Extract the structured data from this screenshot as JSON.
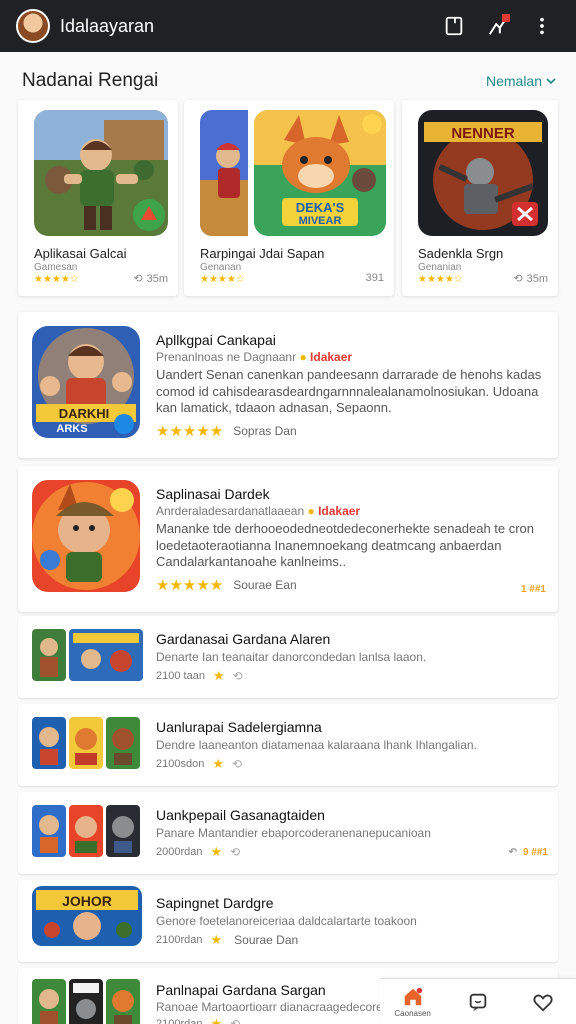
{
  "app": {
    "title": "Idalaayaran"
  },
  "section": {
    "title": "Nadanai Rengai",
    "see_more": "Nemalan"
  },
  "featured": [
    {
      "name": "Aplikasai Galcai",
      "category": "Gamesan",
      "stars": "★★★★☆",
      "downloads": "35m"
    },
    {
      "name": "Rarpingai Jdai Sapan",
      "category": "Genanan",
      "stars": "★★★★☆",
      "downloads": "391"
    },
    {
      "name": "Sadenkla Srgn",
      "category": "Genanian",
      "stars": "★★★★☆",
      "downloads": "35m"
    }
  ],
  "big_cards": [
    {
      "title": "Apllkgpai Cankapai",
      "subtitle": "Prenanlnoas ne Dagnaanr",
      "tag": "Idakaer",
      "description": "Uandert Senan canenkan pandeesann darrarade de henohs kadas comod id cahisdearasdeardngarnnnalealanamolnosiukan. Udoana kan lamatick, tdaaon adnasan, Sepaonn.",
      "rating_text": "Sopras Dan",
      "corner": ""
    },
    {
      "title": "Saplinasai Dardek",
      "subtitle": "Anrderaladesardanatlaaean",
      "tag": "Idakaer",
      "description": "Mananke tde derhooeodedneotdedeconerhekte senadeah te cron loedetaoteraotianna Inanemnoekang deatmcang anbaerdan Candalarkantanoahe kanlneims..",
      "rating_text": "Sourae Ean",
      "corner": "1 ##1"
    }
  ],
  "rows": [
    {
      "title": "Gardanasai Gardana Alaren",
      "subtitle": "Denarte Ian teanaitar danorcondedan lanlsa laaon.",
      "downloads": "2100 taan",
      "corner_left": "",
      "corner_right": ""
    },
    {
      "title": "Uanlurapai Sadelergiamna",
      "subtitle": "Dendre laaneanton diatamenaa kalaraana lhank Ihlangalian.",
      "downloads": "2100sdon",
      "corner_left": "",
      "corner_right": ""
    },
    {
      "title": "Uankpepail Gasanagtaiden",
      "subtitle": "Panare Mantandier ebaporcoderanenanepucanioan",
      "downloads": "2000rdan",
      "corner_left": "↶",
      "corner_right": "9 ##1"
    },
    {
      "title": "Sapingnet Dardgre",
      "subtitle": "Genore foetelanoreiceriaa daldcalartarte toakoon",
      "downloads": "2100rdan",
      "extra": "Sourae Dan",
      "corner_left": "",
      "corner_right": ""
    },
    {
      "title": "Panlnapai Gardana Sargan",
      "subtitle": "Ranoae Martoaortioarr dianacraagedecorersioamai",
      "downloads": "2100rdan",
      "corner_left": "",
      "corner_right": ""
    }
  ],
  "bottom_nav": {
    "home_label": "Caonasen"
  },
  "colors": {
    "accent": "#1c8a86",
    "topbar": "#202124",
    "star": "#f5b700",
    "tag": "#e53935"
  }
}
